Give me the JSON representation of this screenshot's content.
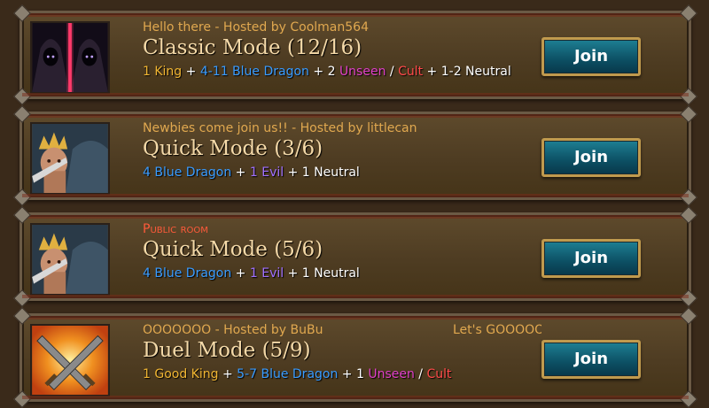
{
  "colors": {
    "subtitle": "#e0a84f",
    "public_room": "#ff5a3a",
    "title": "#f4d9a8",
    "king": "#f0b532",
    "blue_dragon": "#3a9cff",
    "unseen": "#e040c8",
    "cult": "#ff4a4a",
    "evil": "#a070ff",
    "neutral": "#ffffff",
    "join_bg": "#0c4f63",
    "join_border": "#c09a4e"
  },
  "rooms": [
    {
      "avatar_icon": "hooded-figures-icon",
      "subtitle": "Hello there - Hosted by Coolman564",
      "subtitle_extra": "",
      "title": "Classic Mode (12/16)",
      "roles": [
        {
          "text": "1 King",
          "color": "#f0b532"
        },
        {
          "text": " + ",
          "color": "#ffffff"
        },
        {
          "text": "4-11 Blue Dragon",
          "color": "#3a9cff"
        },
        {
          "text": " + 2 ",
          "color": "#ffffff"
        },
        {
          "text": "Unseen",
          "color": "#e040c8"
        },
        {
          "text": " / ",
          "color": "#ffffff"
        },
        {
          "text": "Cult",
          "color": "#ff4a4a"
        },
        {
          "text": " + 1-2 Neutral",
          "color": "#ffffff"
        }
      ],
      "join_label": "Join"
    },
    {
      "avatar_icon": "king-portrait-icon",
      "subtitle": "Newbies come join us!! - Hosted by littlecan",
      "subtitle_extra": "",
      "title": "Quick Mode (3/6)",
      "roles": [
        {
          "text": "4 Blue Dragon",
          "color": "#3a9cff"
        },
        {
          "text": " + ",
          "color": "#ffffff"
        },
        {
          "text": "1 Evil",
          "color": "#a070ff"
        },
        {
          "text": " + 1 Neutral",
          "color": "#ffffff"
        }
      ],
      "join_label": "Join"
    },
    {
      "avatar_icon": "king-portrait-icon",
      "subtitle": "Public room",
      "subtitle_public": true,
      "subtitle_extra": "",
      "title": "Quick Mode (5/6)",
      "roles": [
        {
          "text": "4 Blue Dragon",
          "color": "#3a9cff"
        },
        {
          "text": " + ",
          "color": "#ffffff"
        },
        {
          "text": "1 Evil",
          "color": "#a070ff"
        },
        {
          "text": " + 1 Neutral",
          "color": "#ffffff"
        }
      ],
      "join_label": "Join"
    },
    {
      "avatar_icon": "crossed-swords-icon",
      "subtitle": "OOOOOOO - Hosted by BuBu",
      "subtitle_extra": "Let's GOOOOO",
      "title": "Duel Mode (5/9)",
      "roles": [
        {
          "text": "1 Good King",
          "color": "#f0b532"
        },
        {
          "text": " + ",
          "color": "#ffffff"
        },
        {
          "text": "5-7 Blue Dragon",
          "color": "#3a9cff"
        },
        {
          "text": " + 1 ",
          "color": "#ffffff"
        },
        {
          "text": "Unseen",
          "color": "#e040c8"
        },
        {
          "text": " / ",
          "color": "#ffffff"
        },
        {
          "text": "Cult",
          "color": "#ff4a4a"
        }
      ],
      "join_label": "Join"
    }
  ]
}
